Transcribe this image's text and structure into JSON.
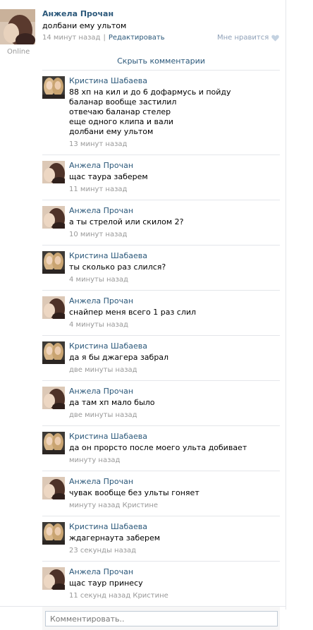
{
  "post": {
    "author": "Анжела Прочан",
    "text": "долбани ему ультом",
    "time": "14 минут назад",
    "separator": "|",
    "edit_label": "Редактировать",
    "like_label": "Мне нравится",
    "online_label": "Online"
  },
  "hide_comments_label": "Скрыть комментарии",
  "comments": [
    {
      "author": "Кристина Шабаева",
      "text": "88 хп на кил и до 6 дофармусь и пойду\nбаланар вообще застилил\nотвечаю баланар стелер\nеще одного клипа и вали\nдолбани ему ультом",
      "meta": "13 минут назад",
      "avatar": "blonde"
    },
    {
      "author": "Анжела Прочан",
      "text": "щас таура заберем",
      "meta": "11 минут назад",
      "avatar": "dark"
    },
    {
      "author": "Анжела Прочан",
      "text": "а ты стрелой или скилом 2?",
      "meta": "10 минут назад",
      "avatar": "dark"
    },
    {
      "author": "Кристина Шабаева",
      "text": "ты сколько раз слился?",
      "meta": "4 минуты назад",
      "avatar": "blonde"
    },
    {
      "author": "Анжела Прочан",
      "text": "снайпер меня всего 1 раз слил",
      "meta": "4 минуты назад",
      "avatar": "dark"
    },
    {
      "author": "Кристина Шабаева",
      "text": "да я бы джагера забрал",
      "meta": "две минуты назад",
      "avatar": "blonde"
    },
    {
      "author": "Анжела Прочан",
      "text": "да там хп мало было",
      "meta": "две минуты назад",
      "avatar": "dark"
    },
    {
      "author": "Кристина Шабаева",
      "text": "да он прорсто после моего ульта добивает",
      "meta": "минуту назад",
      "avatar": "blonde"
    },
    {
      "author": "Анжела Прочан",
      "text": "чувак вообще без ульты гоняет",
      "meta": "минуту назад Кристине",
      "avatar": "dark"
    },
    {
      "author": "Кристина Шабаева",
      "text": "ждагернаута заберем",
      "meta": "23 секунды назад",
      "avatar": "blonde"
    },
    {
      "author": "Анжела Прочан",
      "text": "щас таур принесу",
      "meta": "11 секунд назад Кристине",
      "avatar": "dark"
    }
  ],
  "comment_input": {
    "placeholder": "Комментировать.."
  },
  "colors": {
    "link": "#2b587a",
    "meta": "#999999",
    "divider": "#e4e6ea",
    "like": "#8fa1b8"
  }
}
